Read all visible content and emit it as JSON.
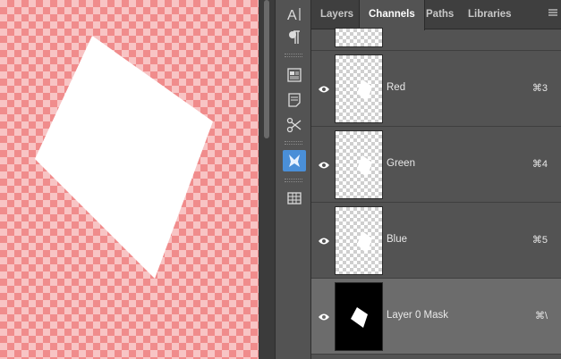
{
  "tabs": [
    {
      "label": "Layers",
      "active": false
    },
    {
      "label": "Channels",
      "active": true
    },
    {
      "label": "Paths",
      "active": false
    },
    {
      "label": "Libraries",
      "active": false
    }
  ],
  "panel_menu_icon": "hamburger-menu-icon",
  "channels": [
    {
      "name": "Red",
      "shortcut": "⌘3",
      "visible": true,
      "selected": false,
      "thumb": "checker"
    },
    {
      "name": "Green",
      "shortcut": "⌘4",
      "visible": true,
      "selected": false,
      "thumb": "checker"
    },
    {
      "name": "Blue",
      "shortcut": "⌘5",
      "visible": true,
      "selected": false,
      "thumb": "checker"
    },
    {
      "name": "Layer 0 Mask",
      "shortcut": "⌘\\",
      "visible": true,
      "selected": true,
      "thumb": "mask"
    }
  ],
  "tools": [
    {
      "icon": "character-text-icon",
      "glyph": "A|"
    },
    {
      "icon": "paragraph-icon",
      "glyph": "¶"
    },
    {
      "icon": "properties-icon",
      "glyph": "▤"
    },
    {
      "icon": "notes-icon",
      "glyph": "▥"
    },
    {
      "icon": "brush-settings-icon",
      "glyph": "✂"
    },
    {
      "icon": "clone-source-icon",
      "glyph": "♞"
    },
    {
      "icon": "grid-panel-icon",
      "glyph": "⊞"
    }
  ],
  "colors": {
    "canvas_checker_light": "#f8c4c4",
    "canvas_checker_dark": "#f08c8c",
    "panel_bg": "#535353",
    "selected_row": "#6c6c6c",
    "active_tool": "#4a8fd8"
  }
}
